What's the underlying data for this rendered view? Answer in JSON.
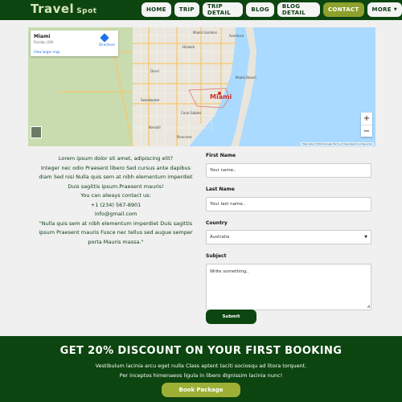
{
  "brand": {
    "name": "Travel",
    "suffix": "Spot"
  },
  "nav": {
    "items": [
      {
        "label": "HOME"
      },
      {
        "label": "TRIP"
      },
      {
        "label": "TRIP DETAIL"
      },
      {
        "label": "BLOG"
      },
      {
        "label": "BLOG DETAIL"
      },
      {
        "label": "CONTACT",
        "active": true
      },
      {
        "label": "MORE"
      }
    ]
  },
  "map": {
    "place": "Miami",
    "region": "Florida, USA",
    "larger_map": "View larger map",
    "directions": "Directions",
    "city_label": "Miami",
    "labels": [
      "Hialeah",
      "Miami Gardens",
      "Aventura",
      "Miami Beach",
      "Coral Gables",
      "Doral",
      "Kendall",
      "Pinecrest",
      "Sweetwater"
    ],
    "footer": "Map data ©2019 Google   Terms of Use   Report a map error",
    "zoom_in": "+",
    "zoom_out": "−"
  },
  "info": {
    "l1": "Lorem ipsum dolor sit amet, adipiscing elit?",
    "l2": "Integer nec odio Praesent libero Sed cursus ante dapibus",
    "l3": "diam Sed nisi Nulla quis sem at nibh elementum imperdiet",
    "l4": "Duis sagittis ipsum.Praesent mauris!",
    "l5": "You can always contact us:",
    "phone": "+1 (234) 567-8901",
    "email": "info@gmail.com",
    "q1": "\"Nulla quis sem at nibh elementum imperdiet Duis sagittis",
    "q2": "ipsum Praesent mauris Fusce nec tellus sed augue semper",
    "q3": "porta Mauris massa.\""
  },
  "form": {
    "first_name_label": "First Name",
    "first_name_placeholder": "Your name..",
    "last_name_label": "Last Name",
    "last_name_placeholder": "Your last name..",
    "country_label": "Country",
    "country_value": "Australia",
    "subject_label": "Subject",
    "subject_placeholder": "Write something..",
    "submit_label": "Submit"
  },
  "banner": {
    "title": "GET 20% DISCOUNT ON YOUR FIRST BOOKING",
    "line1": "Vestibulum lacinia arcu eget nulla Class aptent taciti sociosqu ad litora torquent.",
    "line2": "Per inceptos himenaeos ligula in libero dignissim lacinia nunc!",
    "button": "Book Package"
  },
  "colors": {
    "primary": "#0d4510",
    "accent": "#8fa12d",
    "button_accent": "#9db035"
  }
}
